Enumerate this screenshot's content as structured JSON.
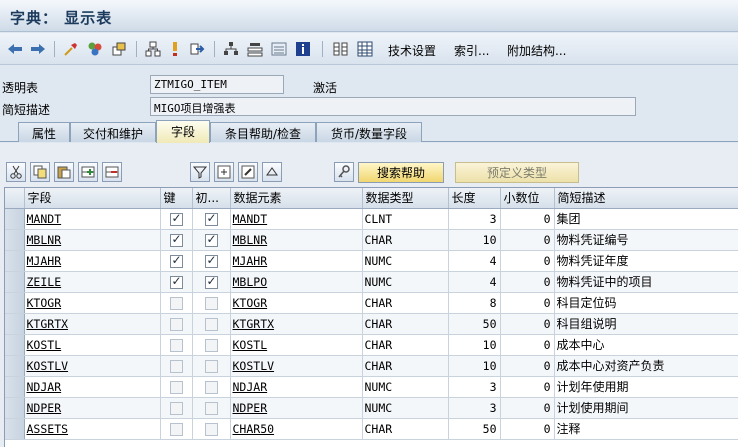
{
  "window": {
    "title": "字典： 显示表"
  },
  "toolbar": {
    "icons": [
      "back-arrow-icon",
      "forward-arrow-icon",
      "glasses-icon",
      "objects-icon",
      "other-object-icon",
      "hierarchy-icon",
      "activate-icon",
      "navigate-icon",
      "layout-icon",
      "tree-icon",
      "list-icon",
      "info-icon",
      "fields-icon",
      "grid-icon"
    ],
    "tech_settings_label": "技术设置",
    "index_label": "索引...",
    "append_structure_label": "附加结构..."
  },
  "header": {
    "table_label": "透明表",
    "table_value": "ZTMIGO_ITEM",
    "status": "激活",
    "desc_label": "简短描述",
    "desc_value": "MIGO项目增强表"
  },
  "tabs": [
    {
      "label": "属性",
      "active": false
    },
    {
      "label": "交付和维护",
      "active": false
    },
    {
      "label": "字段",
      "active": true
    },
    {
      "label": "条目帮助/检查",
      "active": false
    },
    {
      "label": "货币/数量字段",
      "active": false
    }
  ],
  "grid_toolbar": {
    "icons": [
      "cut-icon",
      "copy-icon",
      "paste-icon",
      "insert-row-icon",
      "delete-row-icon",
      "filter-icon",
      "insert-icon",
      "edit-icon",
      "up-icon",
      "key-icon"
    ],
    "search_help_label": "搜索帮助",
    "predefined_type_label": "预定义类型"
  },
  "grid": {
    "columns": [
      "字段",
      "键",
      "初...",
      "数据元素",
      "数据类型",
      "长度",
      "小数位",
      "简短描述"
    ],
    "rows": [
      {
        "field": "MANDT",
        "key": true,
        "init": true,
        "data_element": "MANDT",
        "data_type": "CLNT",
        "length": "3",
        "decimals": "0",
        "description": "集团"
      },
      {
        "field": "MBLNR",
        "key": true,
        "init": true,
        "data_element": "MBLNR",
        "data_type": "CHAR",
        "length": "10",
        "decimals": "0",
        "description": "物料凭证编号"
      },
      {
        "field": "MJAHR",
        "key": true,
        "init": true,
        "data_element": "MJAHR",
        "data_type": "NUMC",
        "length": "4",
        "decimals": "0",
        "description": "物料凭证年度"
      },
      {
        "field": "ZEILE",
        "key": true,
        "init": true,
        "data_element": "MBLPO",
        "data_type": "NUMC",
        "length": "4",
        "decimals": "0",
        "description": "物料凭证中的项目"
      },
      {
        "field": "KTOGR",
        "key": false,
        "init": false,
        "data_element": "KTOGR",
        "data_type": "CHAR",
        "length": "8",
        "decimals": "0",
        "description": "科目定位码"
      },
      {
        "field": "KTGRTX",
        "key": false,
        "init": false,
        "data_element": "KTGRTX",
        "data_type": "CHAR",
        "length": "50",
        "decimals": "0",
        "description": "科目组说明"
      },
      {
        "field": "KOSTL",
        "key": false,
        "init": false,
        "data_element": "KOSTL",
        "data_type": "CHAR",
        "length": "10",
        "decimals": "0",
        "description": "成本中心"
      },
      {
        "field": "KOSTLV",
        "key": false,
        "init": false,
        "data_element": "KOSTLV",
        "data_type": "CHAR",
        "length": "10",
        "decimals": "0",
        "description": "成本中心对资产负责"
      },
      {
        "field": "NDJAR",
        "key": false,
        "init": false,
        "data_element": "NDJAR",
        "data_type": "NUMC",
        "length": "3",
        "decimals": "0",
        "description": "计划年使用期"
      },
      {
        "field": "NDPER",
        "key": false,
        "init": false,
        "data_element": "NDPER",
        "data_type": "NUMC",
        "length": "3",
        "decimals": "0",
        "description": "计划使用期间"
      },
      {
        "field": "ASSETS",
        "key": false,
        "init": false,
        "data_element": "CHAR50",
        "data_type": "CHAR",
        "length": "50",
        "decimals": "0",
        "description": "注释"
      }
    ]
  },
  "colors": {
    "tab_active": "#f0e9b6",
    "search_button": "#f1d770",
    "titlebar_text": "#1b3a5c"
  }
}
